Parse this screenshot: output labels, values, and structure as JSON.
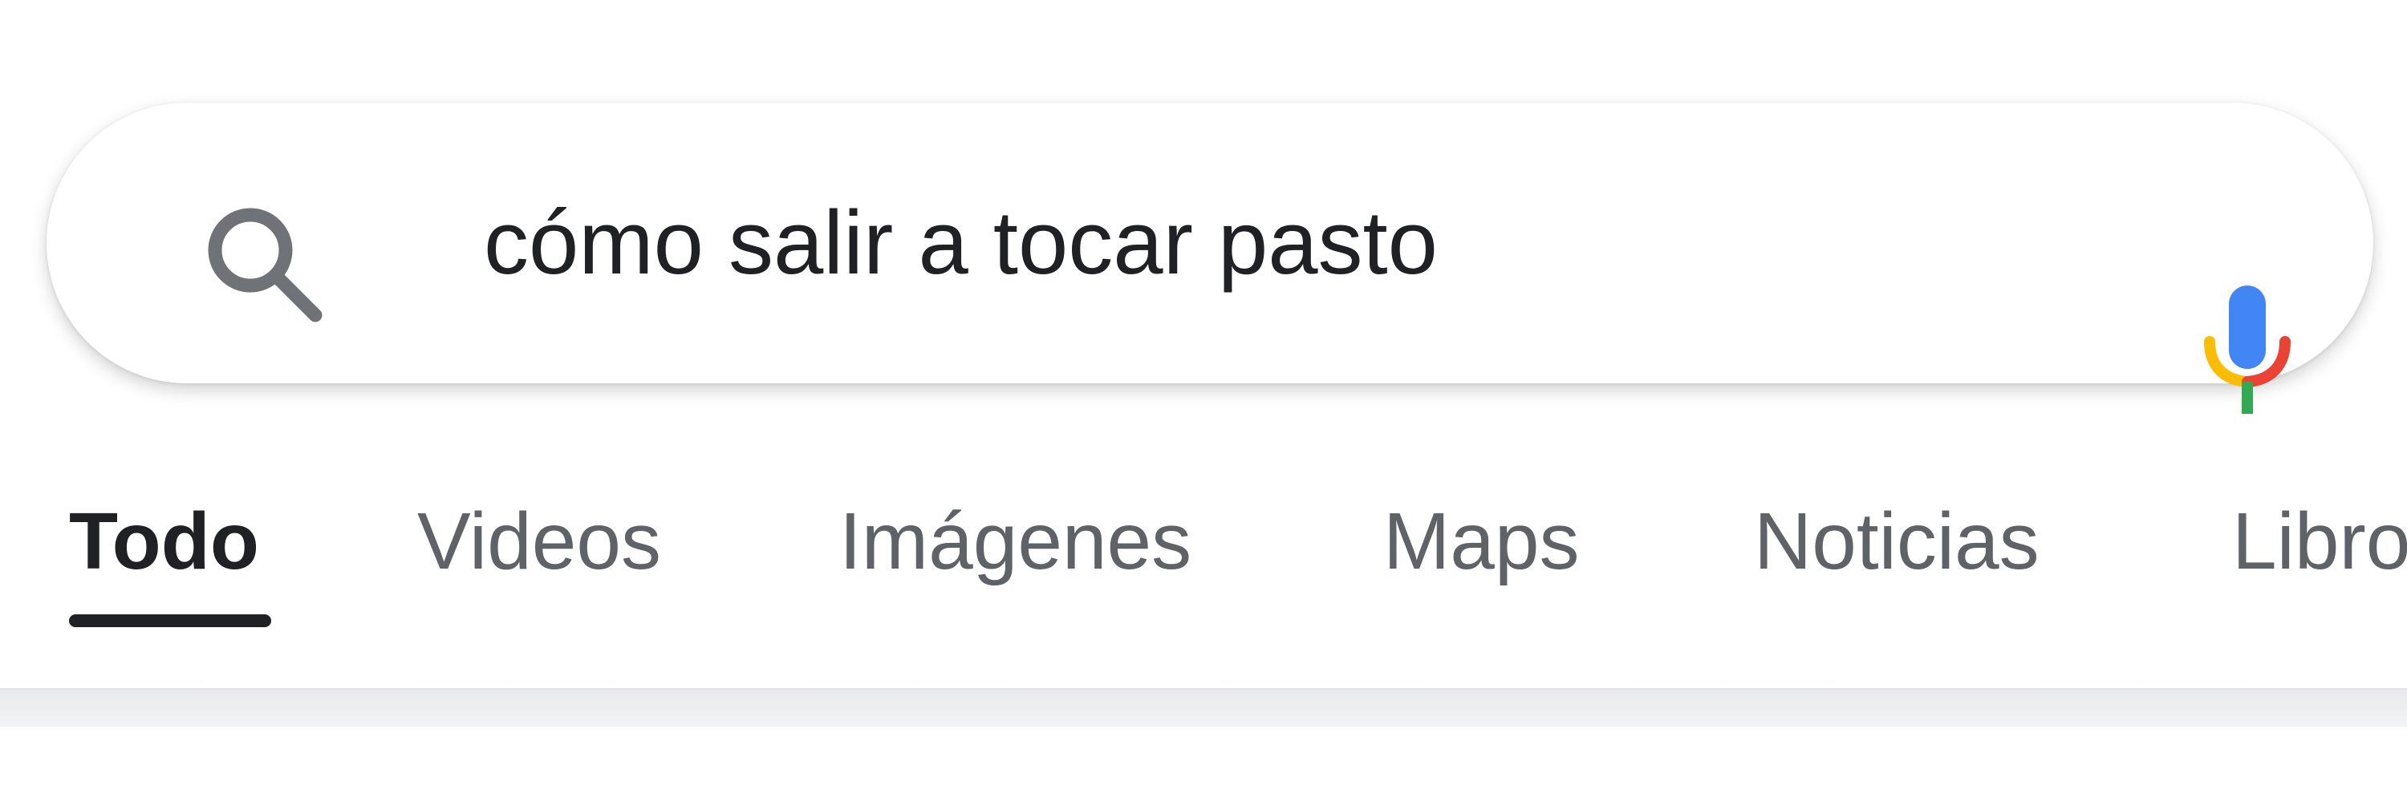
{
  "search": {
    "query": "cómo salir a tocar pasto",
    "search_icon": "search-icon",
    "mic_icon": "microphone-icon"
  },
  "tabs": [
    {
      "label": "Todo",
      "active": true
    },
    {
      "label": "Videos",
      "active": false
    },
    {
      "label": "Imágenes",
      "active": false
    },
    {
      "label": "Maps",
      "active": false
    },
    {
      "label": "Noticias",
      "active": false
    },
    {
      "label": "Libros",
      "active": false
    }
  ],
  "colors": {
    "text_primary": "#202124",
    "text_secondary": "#5f6368",
    "mic_blue": "#4285F4",
    "mic_red": "#EA4335",
    "mic_yellow": "#FBBC05",
    "mic_green": "#34A853"
  }
}
